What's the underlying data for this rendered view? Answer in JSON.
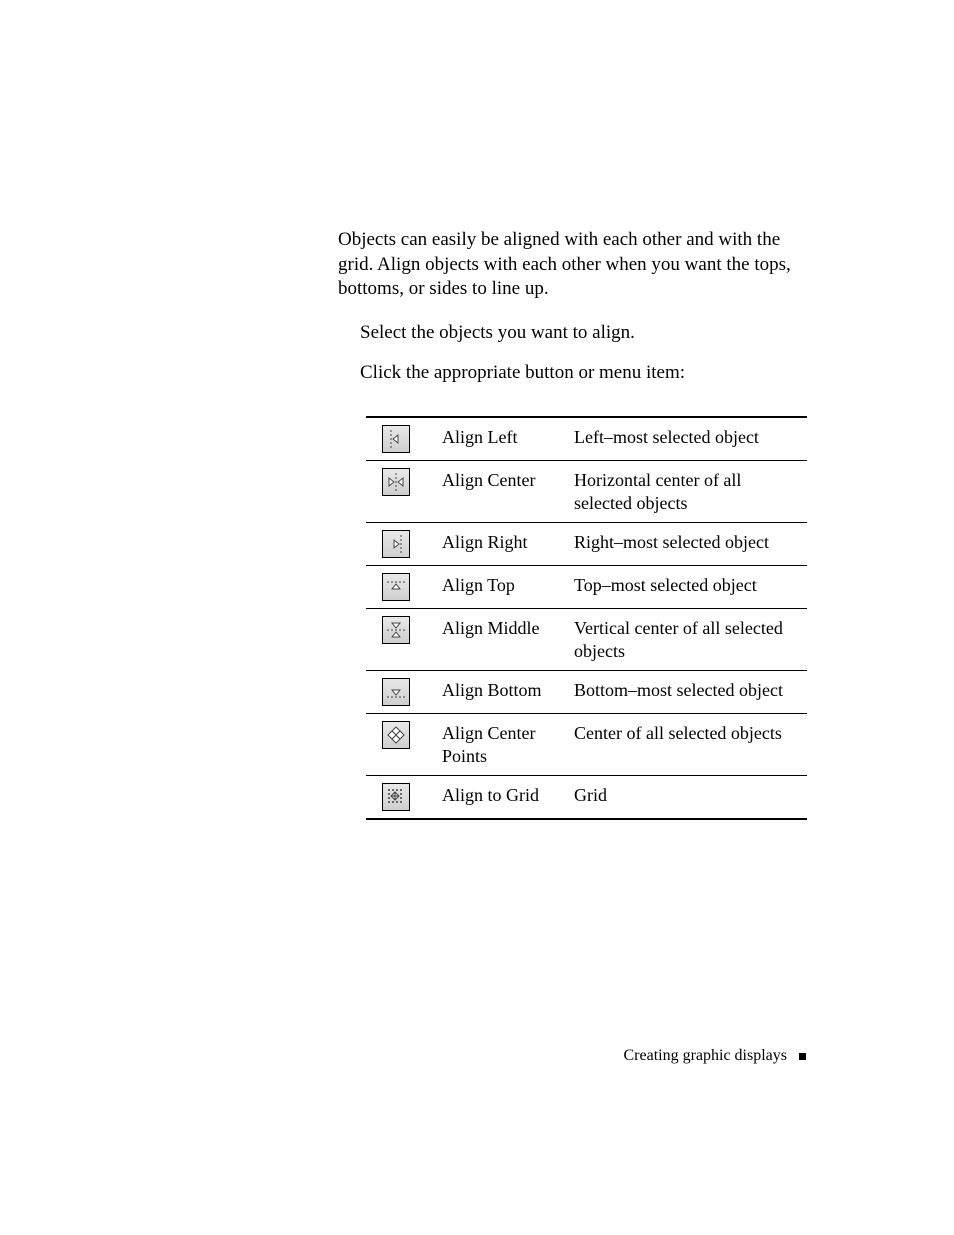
{
  "intro": "Objects can easily be aligned with each other and with the grid. Align objects with each other when you want the tops, bottoms, or sides to line up.",
  "steps": [
    "Select the objects you want to align.",
    "Click the appropriate button or menu item:"
  ],
  "table": [
    {
      "icon": "align-left",
      "name": "Align Left",
      "desc": "Left–most selected object"
    },
    {
      "icon": "align-center",
      "name": "Align Center",
      "desc": "Horizontal center of all selected objects"
    },
    {
      "icon": "align-right",
      "name": "Align Right",
      "desc": "Right–most selected object"
    },
    {
      "icon": "align-top",
      "name": "Align Top",
      "desc": "Top–most selected object"
    },
    {
      "icon": "align-middle",
      "name": "Align Middle",
      "desc": "Vertical center of all selected objects"
    },
    {
      "icon": "align-bottom",
      "name": "Align Bottom",
      "desc": "Bottom–most selected object"
    },
    {
      "icon": "align-center-points",
      "name": "Align Center Points",
      "desc": "Center of all selected objects"
    },
    {
      "icon": "align-to-grid",
      "name": "Align to Grid",
      "desc": "Grid"
    }
  ],
  "footer": "Creating graphic displays"
}
